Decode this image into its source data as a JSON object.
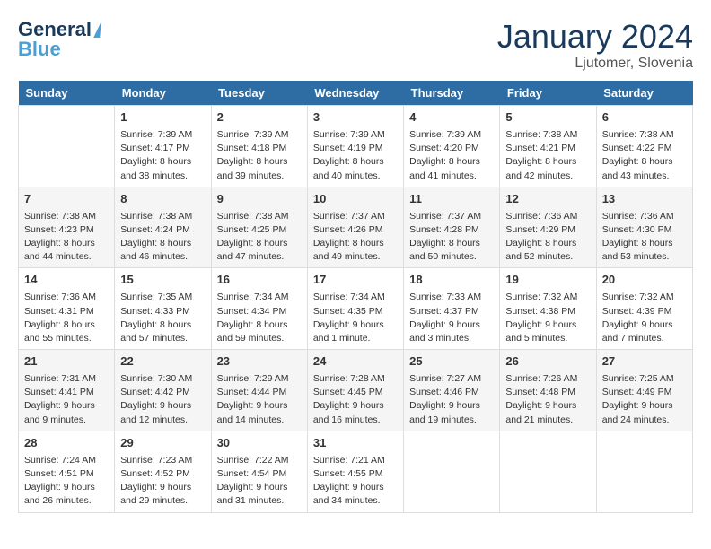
{
  "header": {
    "logo_line1": "General",
    "logo_line2": "Blue",
    "month": "January 2024",
    "location": "Ljutomer, Slovenia"
  },
  "days_of_week": [
    "Sunday",
    "Monday",
    "Tuesday",
    "Wednesday",
    "Thursday",
    "Friday",
    "Saturday"
  ],
  "weeks": [
    [
      {
        "day": "",
        "sunrise": "",
        "sunset": "",
        "daylight": ""
      },
      {
        "day": "1",
        "sunrise": "Sunrise: 7:39 AM",
        "sunset": "Sunset: 4:17 PM",
        "daylight": "Daylight: 8 hours and 38 minutes."
      },
      {
        "day": "2",
        "sunrise": "Sunrise: 7:39 AM",
        "sunset": "Sunset: 4:18 PM",
        "daylight": "Daylight: 8 hours and 39 minutes."
      },
      {
        "day": "3",
        "sunrise": "Sunrise: 7:39 AM",
        "sunset": "Sunset: 4:19 PM",
        "daylight": "Daylight: 8 hours and 40 minutes."
      },
      {
        "day": "4",
        "sunrise": "Sunrise: 7:39 AM",
        "sunset": "Sunset: 4:20 PM",
        "daylight": "Daylight: 8 hours and 41 minutes."
      },
      {
        "day": "5",
        "sunrise": "Sunrise: 7:38 AM",
        "sunset": "Sunset: 4:21 PM",
        "daylight": "Daylight: 8 hours and 42 minutes."
      },
      {
        "day": "6",
        "sunrise": "Sunrise: 7:38 AM",
        "sunset": "Sunset: 4:22 PM",
        "daylight": "Daylight: 8 hours and 43 minutes."
      }
    ],
    [
      {
        "day": "7",
        "sunrise": "Sunrise: 7:38 AM",
        "sunset": "Sunset: 4:23 PM",
        "daylight": "Daylight: 8 hours and 44 minutes."
      },
      {
        "day": "8",
        "sunrise": "Sunrise: 7:38 AM",
        "sunset": "Sunset: 4:24 PM",
        "daylight": "Daylight: 8 hours and 46 minutes."
      },
      {
        "day": "9",
        "sunrise": "Sunrise: 7:38 AM",
        "sunset": "Sunset: 4:25 PM",
        "daylight": "Daylight: 8 hours and 47 minutes."
      },
      {
        "day": "10",
        "sunrise": "Sunrise: 7:37 AM",
        "sunset": "Sunset: 4:26 PM",
        "daylight": "Daylight: 8 hours and 49 minutes."
      },
      {
        "day": "11",
        "sunrise": "Sunrise: 7:37 AM",
        "sunset": "Sunset: 4:28 PM",
        "daylight": "Daylight: 8 hours and 50 minutes."
      },
      {
        "day": "12",
        "sunrise": "Sunrise: 7:36 AM",
        "sunset": "Sunset: 4:29 PM",
        "daylight": "Daylight: 8 hours and 52 minutes."
      },
      {
        "day": "13",
        "sunrise": "Sunrise: 7:36 AM",
        "sunset": "Sunset: 4:30 PM",
        "daylight": "Daylight: 8 hours and 53 minutes."
      }
    ],
    [
      {
        "day": "14",
        "sunrise": "Sunrise: 7:36 AM",
        "sunset": "Sunset: 4:31 PM",
        "daylight": "Daylight: 8 hours and 55 minutes."
      },
      {
        "day": "15",
        "sunrise": "Sunrise: 7:35 AM",
        "sunset": "Sunset: 4:33 PM",
        "daylight": "Daylight: 8 hours and 57 minutes."
      },
      {
        "day": "16",
        "sunrise": "Sunrise: 7:34 AM",
        "sunset": "Sunset: 4:34 PM",
        "daylight": "Daylight: 8 hours and 59 minutes."
      },
      {
        "day": "17",
        "sunrise": "Sunrise: 7:34 AM",
        "sunset": "Sunset: 4:35 PM",
        "daylight": "Daylight: 9 hours and 1 minute."
      },
      {
        "day": "18",
        "sunrise": "Sunrise: 7:33 AM",
        "sunset": "Sunset: 4:37 PM",
        "daylight": "Daylight: 9 hours and 3 minutes."
      },
      {
        "day": "19",
        "sunrise": "Sunrise: 7:32 AM",
        "sunset": "Sunset: 4:38 PM",
        "daylight": "Daylight: 9 hours and 5 minutes."
      },
      {
        "day": "20",
        "sunrise": "Sunrise: 7:32 AM",
        "sunset": "Sunset: 4:39 PM",
        "daylight": "Daylight: 9 hours and 7 minutes."
      }
    ],
    [
      {
        "day": "21",
        "sunrise": "Sunrise: 7:31 AM",
        "sunset": "Sunset: 4:41 PM",
        "daylight": "Daylight: 9 hours and 9 minutes."
      },
      {
        "day": "22",
        "sunrise": "Sunrise: 7:30 AM",
        "sunset": "Sunset: 4:42 PM",
        "daylight": "Daylight: 9 hours and 12 minutes."
      },
      {
        "day": "23",
        "sunrise": "Sunrise: 7:29 AM",
        "sunset": "Sunset: 4:44 PM",
        "daylight": "Daylight: 9 hours and 14 minutes."
      },
      {
        "day": "24",
        "sunrise": "Sunrise: 7:28 AM",
        "sunset": "Sunset: 4:45 PM",
        "daylight": "Daylight: 9 hours and 16 minutes."
      },
      {
        "day": "25",
        "sunrise": "Sunrise: 7:27 AM",
        "sunset": "Sunset: 4:46 PM",
        "daylight": "Daylight: 9 hours and 19 minutes."
      },
      {
        "day": "26",
        "sunrise": "Sunrise: 7:26 AM",
        "sunset": "Sunset: 4:48 PM",
        "daylight": "Daylight: 9 hours and 21 minutes."
      },
      {
        "day": "27",
        "sunrise": "Sunrise: 7:25 AM",
        "sunset": "Sunset: 4:49 PM",
        "daylight": "Daylight: 9 hours and 24 minutes."
      }
    ],
    [
      {
        "day": "28",
        "sunrise": "Sunrise: 7:24 AM",
        "sunset": "Sunset: 4:51 PM",
        "daylight": "Daylight: 9 hours and 26 minutes."
      },
      {
        "day": "29",
        "sunrise": "Sunrise: 7:23 AM",
        "sunset": "Sunset: 4:52 PM",
        "daylight": "Daylight: 9 hours and 29 minutes."
      },
      {
        "day": "30",
        "sunrise": "Sunrise: 7:22 AM",
        "sunset": "Sunset: 4:54 PM",
        "daylight": "Daylight: 9 hours and 31 minutes."
      },
      {
        "day": "31",
        "sunrise": "Sunrise: 7:21 AM",
        "sunset": "Sunset: 4:55 PM",
        "daylight": "Daylight: 9 hours and 34 minutes."
      },
      {
        "day": "",
        "sunrise": "",
        "sunset": "",
        "daylight": ""
      },
      {
        "day": "",
        "sunrise": "",
        "sunset": "",
        "daylight": ""
      },
      {
        "day": "",
        "sunrise": "",
        "sunset": "",
        "daylight": ""
      }
    ]
  ]
}
